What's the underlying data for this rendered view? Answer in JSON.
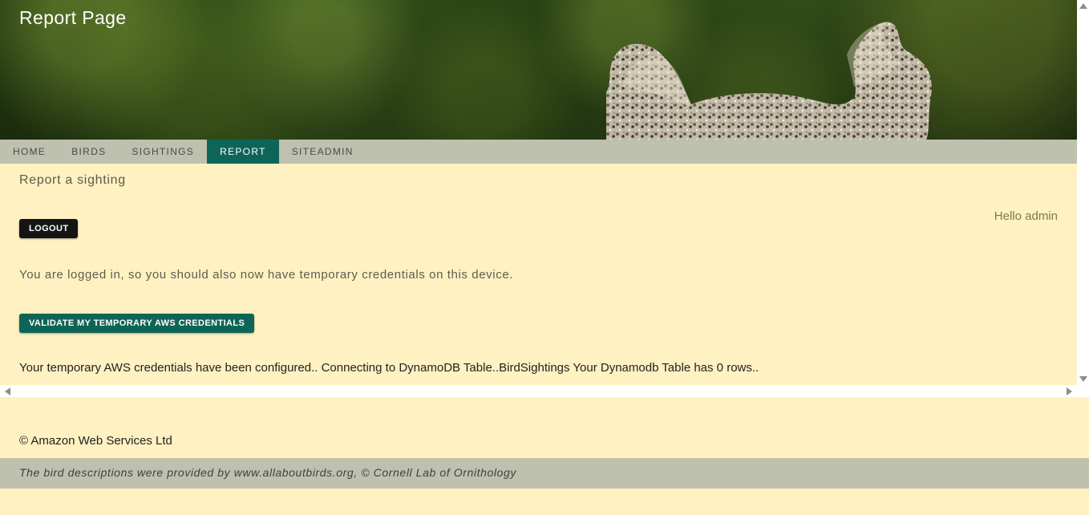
{
  "header": {
    "title": "Report Page"
  },
  "nav": {
    "items": [
      {
        "label": "HOME"
      },
      {
        "label": "BIRDS"
      },
      {
        "label": "SIGHTINGS"
      },
      {
        "label": "REPORT",
        "active": true
      },
      {
        "label": "SITEADMIN"
      }
    ]
  },
  "main": {
    "subtitle": "Report a sighting",
    "logout_label": "LOGOUT",
    "greeting": "Hello admin",
    "status_text": "You are logged in, so you should also now have temporary credentials on this device.",
    "validate_label": "VALIDATE MY TEMPORARY AWS CREDENTIALS",
    "result_text": "Your temporary AWS credentials have been configured.. Connecting to DynamoDB Table..BirdSightings Your Dynamodb Table has 0 rows.."
  },
  "footer": {
    "copyright": "© Amazon Web Services Ltd",
    "attribution": "The bird descriptions were provided by www.allaboutbirds.org, © Cornell Lab of Ornithology"
  },
  "colors": {
    "background": "#fff1c1",
    "nav": "#bec1ad",
    "accent": "#0e6557",
    "logout": "#141414"
  },
  "icons": {
    "scroll_up": "chevron-up-icon",
    "scroll_down": "chevron-down-icon",
    "scroll_left": "chevron-left-icon",
    "scroll_right": "chevron-right-icon"
  }
}
